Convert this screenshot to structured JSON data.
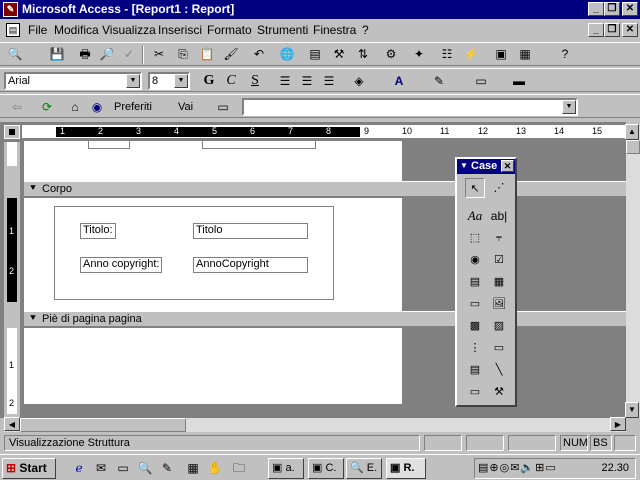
{
  "window": {
    "title": "Microsoft Access - [Report1 : Report]"
  },
  "menu": [
    "File",
    "Modifica",
    "Visualizza",
    "Inserisci",
    "Formato",
    "Strumenti",
    "Finestra",
    "?"
  ],
  "format_bar": {
    "font": "Arial",
    "size": "8"
  },
  "web_bar": {
    "favorites": "Preferiti",
    "go": "Vai"
  },
  "ruler": {
    "numbers": [
      "1",
      "2",
      "3",
      "4",
      "5",
      "6",
      "7",
      "8",
      "9",
      "10",
      "11",
      "12",
      "13",
      "14",
      "15"
    ]
  },
  "sections": {
    "detail": "Corpo",
    "page_footer": "Piè di pagina pagina"
  },
  "controls": {
    "title_label": "Titolo:",
    "title_field": "Titolo",
    "copyright_label": "Anno copyright:",
    "copyright_field": "AnnoCopyright"
  },
  "vruler": {
    "numbers": [
      "1",
      "2",
      "1",
      "2"
    ]
  },
  "toolbox": {
    "title": "Case",
    "text_tool": "ab|",
    "label_tool": "Aa"
  },
  "status": {
    "text": "Visualizzazione Struttura",
    "num": "NUM",
    "bs": "BS"
  },
  "taskbar": {
    "start": "Start",
    "tasks": [
      "a.",
      "C.",
      "E.",
      "R."
    ],
    "clock": "22.30"
  }
}
